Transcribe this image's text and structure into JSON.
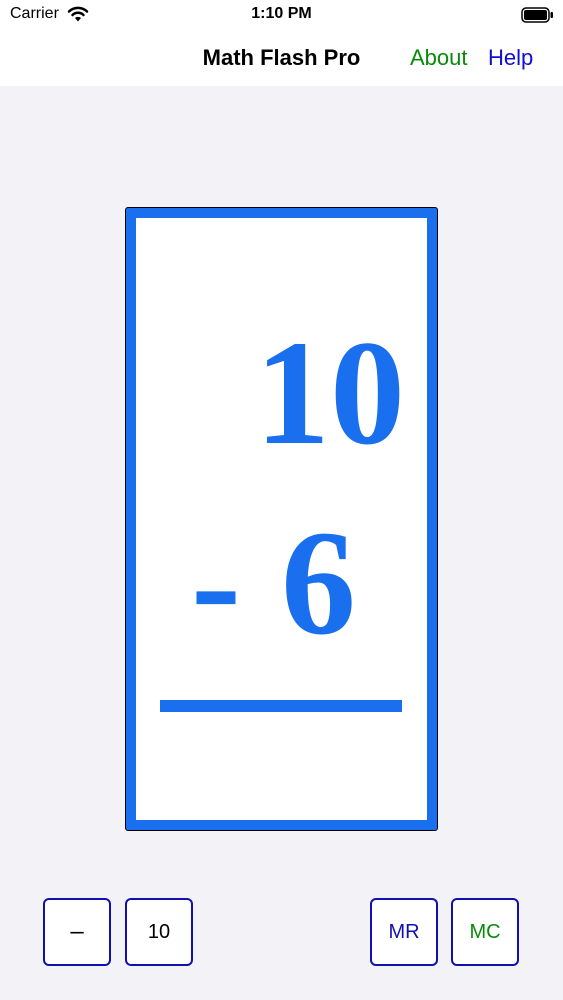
{
  "status_bar": {
    "carrier": "Carrier",
    "time": "1:10 PM",
    "icons": [
      "wifi-icon",
      "battery-icon"
    ]
  },
  "nav": {
    "title": "Math Flash Pro",
    "about_label": "About",
    "help_label": "Help"
  },
  "card": {
    "top_number": "10",
    "operator": "-",
    "bottom_number": "6"
  },
  "buttons": {
    "operation_label": "–",
    "max_label": "10",
    "mr_label": "MR",
    "mc_label": "MC"
  },
  "colors": {
    "card_blue": "#1a6fef",
    "about_green": "#0a8a0a",
    "help_blue": "#1010d0",
    "button_border": "#1010b0",
    "background": "#f2f2f7"
  }
}
